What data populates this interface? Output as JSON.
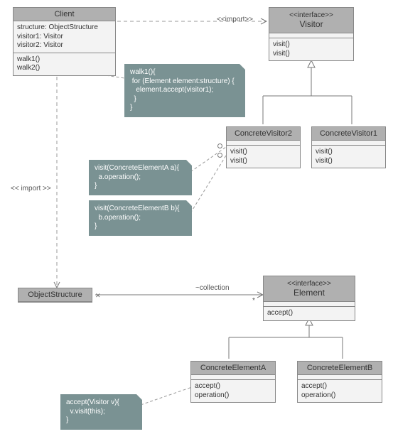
{
  "client": {
    "name": "Client",
    "attrs": [
      "structure: ObjectStructure",
      "visitor1: Visitor",
      "visitor2: Visitor"
    ],
    "ops": [
      "walk1()",
      "walk2()"
    ]
  },
  "visitor": {
    "stereotype": "<<interface>>",
    "name": "Visitor",
    "ops": [
      "visit()",
      "visit()"
    ]
  },
  "concreteVisitor2": {
    "name": "ConcreteVisitor2",
    "ops": [
      "visit()",
      "visit()"
    ]
  },
  "concreteVisitor1": {
    "name": "ConcreteVisitor1",
    "ops": [
      "visit()",
      "visit()"
    ]
  },
  "objectStructure": {
    "name": "ObjectStructure"
  },
  "element": {
    "stereotype": "<<interface>>",
    "name": "Element",
    "ops": [
      "accept()"
    ]
  },
  "concreteElementA": {
    "name": "ConcreteElementA",
    "ops": [
      "accept()",
      "operation()"
    ]
  },
  "concreteElementB": {
    "name": "ConcreteElementB",
    "ops": [
      "accept()",
      "operation()"
    ]
  },
  "notes": {
    "walk1": "walk1(){\n for (Element element:structure) {\n   element.accept(visitor1);\n  }\n}",
    "visitA": "visit(ConcreteElementA a){\n  a.operation();\n}",
    "visitB": "visit(ConcreteElementB b){\n  b.operation();\n}",
    "acceptV": "accept(Visitor v){\n  v.visit(this);\n}"
  },
  "labels": {
    "import1": "<<import>>",
    "import2": "<< import >>",
    "collection": "~collection",
    "star": "*"
  },
  "lollipops": {
    "v1": "visit()",
    "v2": "visit()"
  }
}
